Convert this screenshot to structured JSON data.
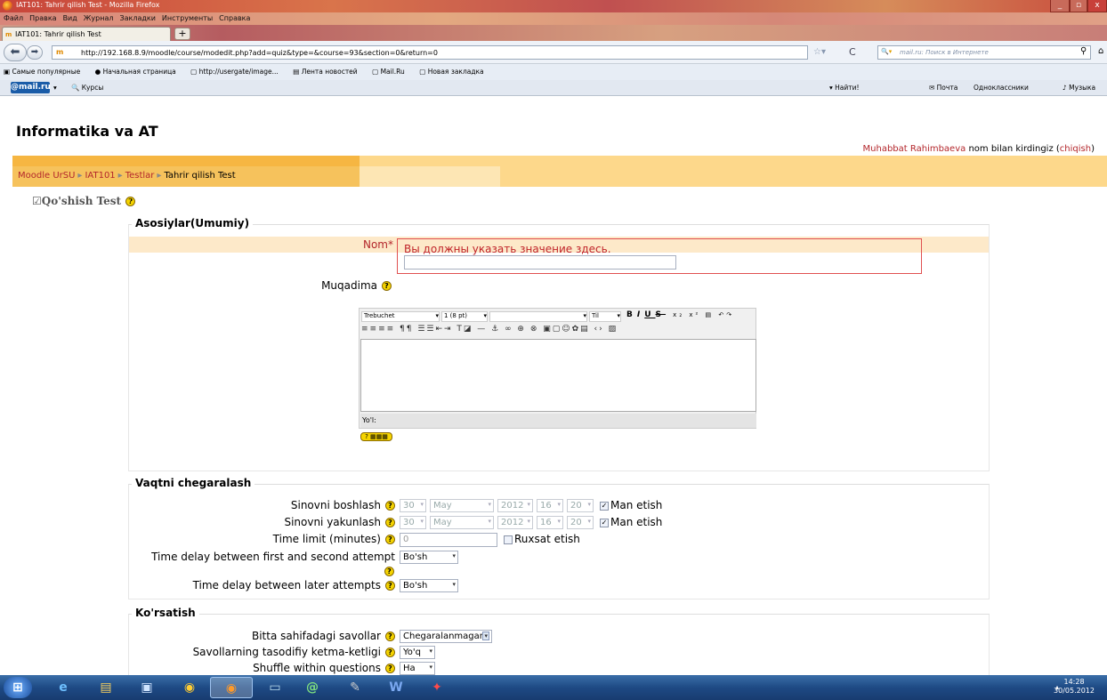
{
  "window": {
    "title": "IAT101: Tahrir qilish Test - Mozilla Firefox"
  },
  "menu": [
    "Файл",
    "Правка",
    "Вид",
    "Журнал",
    "Закладки",
    "Инструменты",
    "Справка"
  ],
  "tab": {
    "title": "IAT101: Tahrir qilish Test",
    "favicon": "m"
  },
  "nav": {
    "url": "http://192.168.8.9/moodle/course/modedit.php?add=quiz&type=&course=93&section=0&return=0",
    "search_placeholder": "mail.ru: Поиск в Интернете"
  },
  "bookmarks": [
    "Самые популярные",
    "Начальная страница",
    "http://usergate/image...",
    "Лента новостей",
    "Mail.Ru",
    "Новая закладка"
  ],
  "mailbar": {
    "logo": "@mail.ru",
    "search": "Курсы",
    "find": "Найти!",
    "items": [
      "Почта",
      "Одноклассники",
      "Музыка"
    ]
  },
  "page": {
    "site_title": "Informatika va AT",
    "user_name": "Muhabbat Rahimbaeva",
    "login_text": " nom bilan kirdingiz (",
    "logout": "chiqish",
    "login_close": ")",
    "breadcrumbs": [
      "Moodle UrSU",
      "IAT101",
      "Testlar",
      "Tahrir qilish Test"
    ],
    "heading": "Qo'shish Test"
  },
  "general": {
    "legend": "Asosiylar(Umumiy)",
    "name_label": "Nom*",
    "name_error": "Вы должны указать значение здесь.",
    "name_value": "",
    "intro_label": "Muqadima",
    "editor": {
      "font": "Trebuchet",
      "size": "1 (8 pt)",
      "style": "",
      "lang": "Til",
      "path_label": "Yo'l:"
    }
  },
  "timing": {
    "legend": "Vaqtni chegaralash",
    "open_label": "Sinovni boshlash",
    "close_label": "Sinovni yakunlash",
    "day": "30",
    "month": "May",
    "year": "2012",
    "hour": "16",
    "minute": "20",
    "disable_label": "Man etish",
    "timelimit_label": "Time limit (minutes)",
    "timelimit_value": "0",
    "enable_label": "Ruxsat etish",
    "delay1_label": "Time delay between first and second attempt",
    "delay1_value": "Bo'sh",
    "delay2_label": "Time delay between later attempts",
    "delay2_value": "Bo'sh"
  },
  "display": {
    "legend": "Ko'rsatish",
    "perpage_label": "Bitta sahifadagi savollar",
    "perpage_value": "Chegaralanmagan",
    "shuffleq_label": "Savollarning tasodifiy ketma-ketligi",
    "shuffleq_value": "Yo'q",
    "shufflea_label": "Shuffle within questions",
    "shufflea_value": "Ha"
  },
  "taskbar": {
    "time": "14:28",
    "date": "30/05.2012"
  },
  "colors": {
    "link": "#b3262b",
    "nav_band": "#fdd88b",
    "nav_band_dark": "#f6b642",
    "error_border": "#e05050"
  }
}
